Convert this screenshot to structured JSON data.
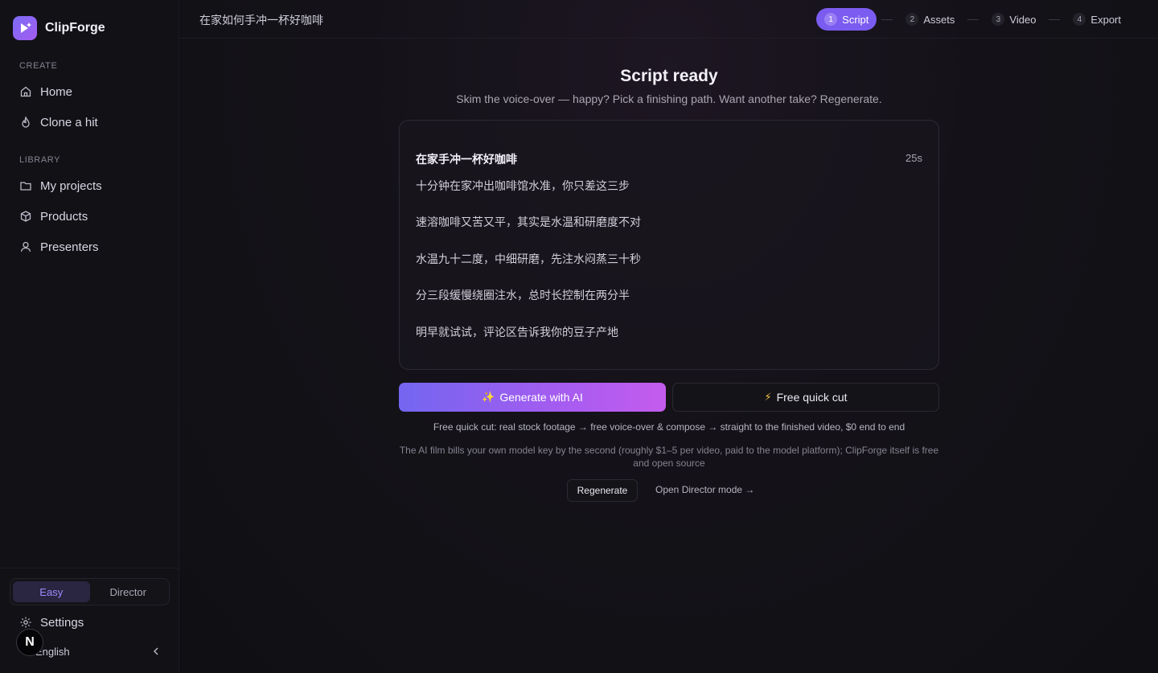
{
  "brand": {
    "name": "ClipForge"
  },
  "sidebar": {
    "create_label": "CREATE",
    "create_items": [
      {
        "label": "Home",
        "icon": "home-icon"
      },
      {
        "label": "Clone a hit",
        "icon": "flame-icon"
      }
    ],
    "library_label": "LIBRARY",
    "library_items": [
      {
        "label": "My projects",
        "icon": "folder-icon"
      },
      {
        "label": "Products",
        "icon": "box-icon"
      },
      {
        "label": "Presenters",
        "icon": "user-icon"
      }
    ],
    "mode": {
      "easy": "Easy",
      "director": "Director",
      "active": "Easy"
    },
    "settings_label": "Settings",
    "language_label": "English",
    "avatar_letter": "N"
  },
  "topbar": {
    "project_title": "在家如何手冲一杯好咖啡",
    "steps": [
      {
        "num": "1",
        "label": "Script",
        "active": true
      },
      {
        "num": "2",
        "label": "Assets",
        "active": false
      },
      {
        "num": "3",
        "label": "Video",
        "active": false
      },
      {
        "num": "4",
        "label": "Export",
        "active": false
      }
    ]
  },
  "main": {
    "heading": "Script ready",
    "subheading": "Skim the voice-over — happy? Pick a finishing path. Want another take? Regenerate.",
    "script": {
      "title": "在家手冲一杯好咖啡",
      "duration": "25s",
      "lines": [
        "十分钟在家冲出咖啡馆水准，你只差这三步",
        "速溶咖啡又苦又平，其实是水温和研磨度不对",
        "水温九十二度，中细研磨，先注水闷蒸三十秒",
        "分三段缓慢绕圈注水，总时长控制在两分半",
        "明早就试试，评论区告诉我你的豆子产地"
      ]
    },
    "generate_label": "Generate with AI",
    "quick_label": "Free quick cut",
    "note_quick": "Free quick cut: real stock footage → free voice-over & compose → straight to the finished video, $0 end to end",
    "note_ai": "The AI film bills your own model key by the second (roughly $1–5 per video, paid to the model platform); ClipForge itself is free and open source",
    "regenerate_label": "Regenerate",
    "director_link": "Open Director mode →"
  },
  "colors": {
    "accent": "#7b5cf0",
    "gradient_start": "#7366f0",
    "gradient_end": "#c45cee"
  }
}
